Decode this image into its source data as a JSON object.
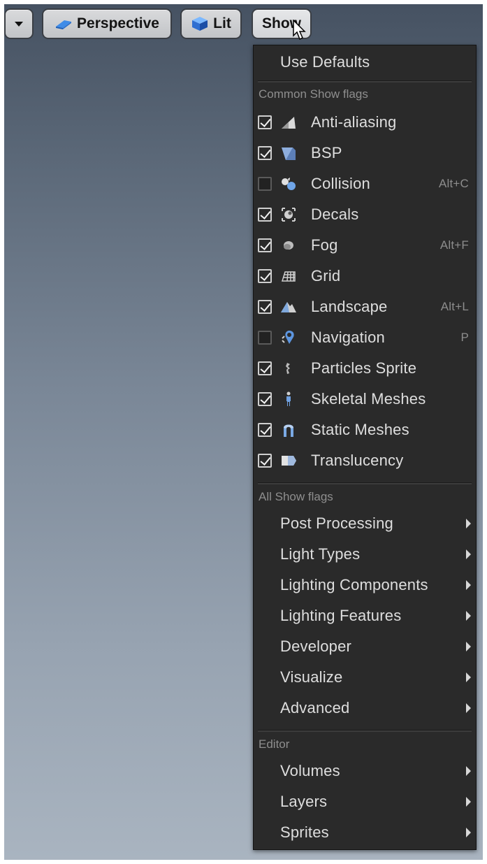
{
  "toolbar": {
    "dropdown_label": "",
    "perspective_label": "Perspective",
    "lit_label": "Lit",
    "show_label": "Show"
  },
  "menu": {
    "use_defaults": "Use Defaults",
    "common_header": "Common Show flags",
    "common_flags": [
      {
        "label": "Anti-aliasing",
        "checked": true,
        "shortcut": "",
        "icon": "anti-aliasing-icon"
      },
      {
        "label": "BSP",
        "checked": true,
        "shortcut": "",
        "icon": "bsp-icon"
      },
      {
        "label": "Collision",
        "checked": false,
        "shortcut": "Alt+C",
        "icon": "collision-icon"
      },
      {
        "label": "Decals",
        "checked": true,
        "shortcut": "",
        "icon": "decals-icon"
      },
      {
        "label": "Fog",
        "checked": true,
        "shortcut": "Alt+F",
        "icon": "fog-icon"
      },
      {
        "label": "Grid",
        "checked": true,
        "shortcut": "",
        "icon": "grid-icon"
      },
      {
        "label": "Landscape",
        "checked": true,
        "shortcut": "Alt+L",
        "icon": "landscape-icon"
      },
      {
        "label": "Navigation",
        "checked": false,
        "shortcut": "P",
        "icon": "navigation-icon"
      },
      {
        "label": "Particles Sprite",
        "checked": true,
        "shortcut": "",
        "icon": "particles-icon"
      },
      {
        "label": "Skeletal Meshes",
        "checked": true,
        "shortcut": "",
        "icon": "skeletal-mesh-icon"
      },
      {
        "label": "Static Meshes",
        "checked": true,
        "shortcut": "",
        "icon": "static-mesh-icon"
      },
      {
        "label": "Translucency",
        "checked": true,
        "shortcut": "",
        "icon": "translucency-icon"
      }
    ],
    "all_header": "All Show flags",
    "all_items": [
      "Post Processing",
      "Light Types",
      "Lighting Components",
      "Lighting Features",
      "Developer",
      "Visualize",
      "Advanced"
    ],
    "editor_header": "Editor",
    "editor_items": [
      "Volumes",
      "Layers",
      "Sprites"
    ]
  }
}
